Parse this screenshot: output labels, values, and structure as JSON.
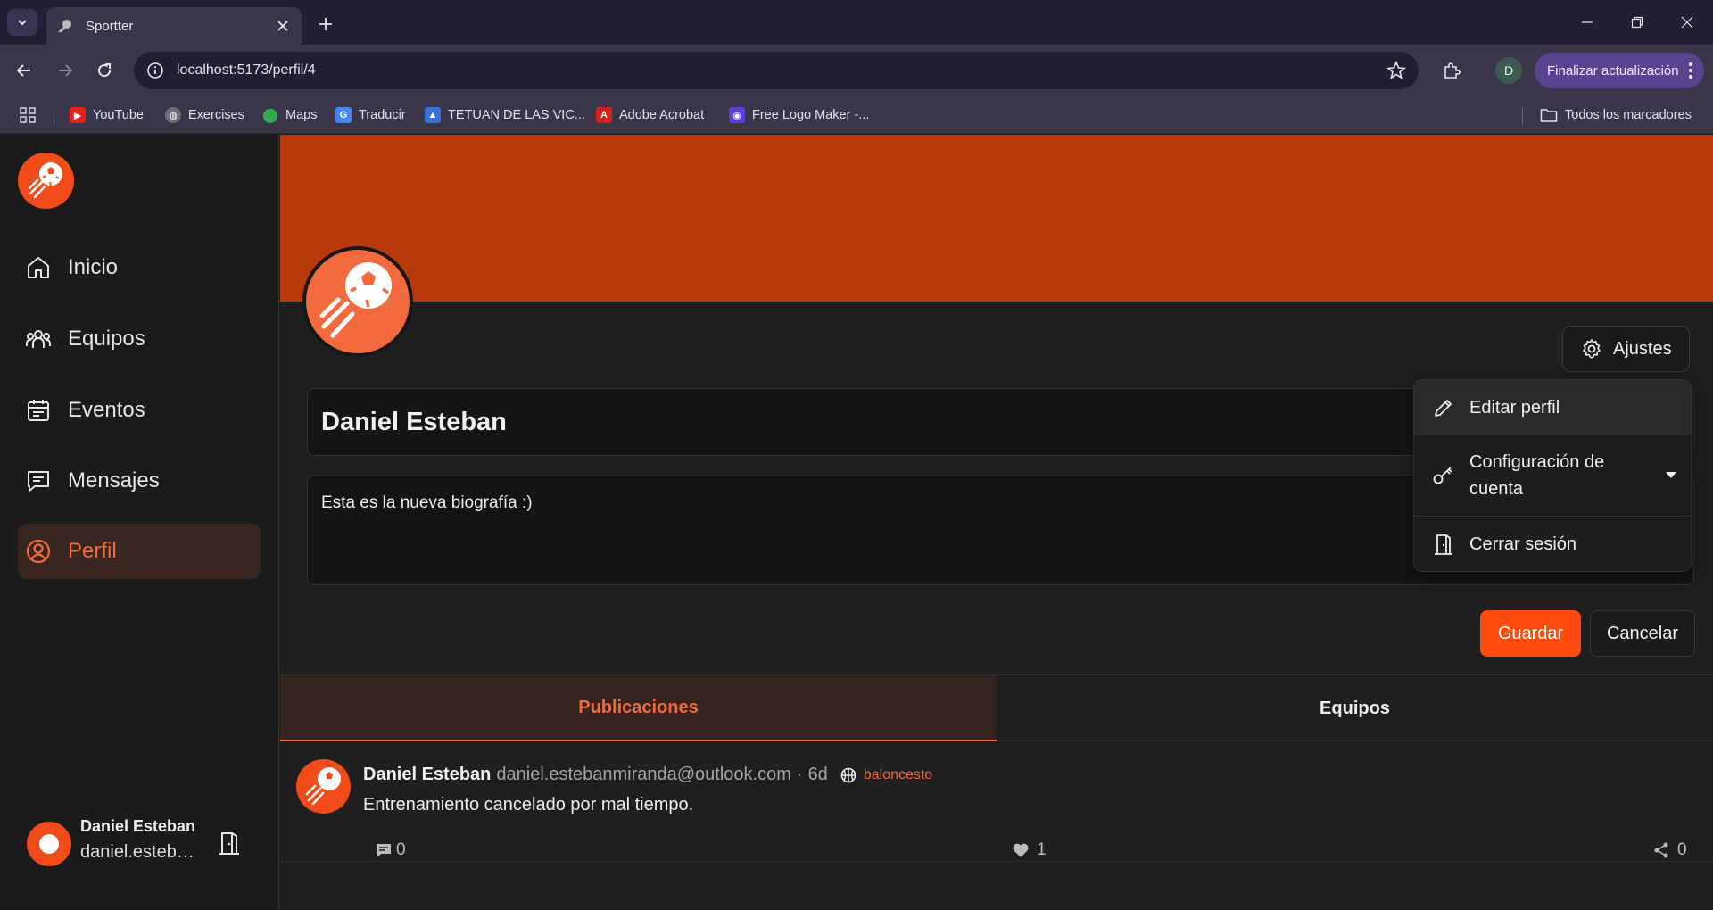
{
  "browser": {
    "tab_title": "Sportter",
    "url": "localhost:5173/perfil/4",
    "profile_initial": "D",
    "update_label": "Finalizar actualización",
    "bookmarks": [
      {
        "label": "YouTube",
        "color": "#e62117",
        "icon": "youtube-icon"
      },
      {
        "label": "Exercises",
        "color": "#9aa0a6",
        "icon": "globe-icon"
      },
      {
        "label": "Maps",
        "color": "#34a853",
        "icon": "maps-icon"
      },
      {
        "label": "Traducir",
        "color": "#4285f4",
        "icon": "translate-icon"
      },
      {
        "label": "TETUAN DE LAS VIC...",
        "color": "#3b6fd8",
        "icon": "graduation-cap-icon"
      },
      {
        "label": "Adobe Acrobat",
        "color": "#d4201a",
        "icon": "acrobat-icon"
      },
      {
        "label": "Free Logo Maker -...",
        "color": "#5b3fd6",
        "icon": "logo-maker-icon"
      }
    ],
    "all_bookmarks": "Todos los marcadores"
  },
  "sidebar": {
    "items": [
      {
        "label": "Inicio",
        "icon": "home-icon"
      },
      {
        "label": "Equipos",
        "icon": "users-icon"
      },
      {
        "label": "Eventos",
        "icon": "calendar-icon"
      },
      {
        "label": "Mensajes",
        "icon": "message-icon"
      },
      {
        "label": "Perfil",
        "icon": "user-circle-icon",
        "active": true
      }
    ],
    "user": {
      "name": "Daniel Esteban",
      "email": "daniel.estebanmiranda@outlook.com"
    }
  },
  "profile": {
    "settings_label": "Ajustes",
    "name": "Daniel Esteban",
    "bio": "Esta es la nueva biografía :)",
    "save_label": "Guardar",
    "cancel_label": "Cancelar",
    "tabs": [
      {
        "label": "Publicaciones",
        "active": true
      },
      {
        "label": "Equipos",
        "active": false
      }
    ],
    "accent_color": "#f26a3d",
    "banner_color": "#b83909"
  },
  "settings_menu": {
    "edit_profile": "Editar perfil",
    "account_config": "Configuración de cuenta",
    "logout": "Cerrar sesión"
  },
  "post": {
    "author": "Daniel Esteban",
    "email": "daniel.estebanmiranda@outlook.com",
    "separator": "·",
    "time": "6d",
    "sport": "baloncesto",
    "text": "Entrenamiento cancelado por mal tiempo.",
    "comments": "0",
    "likes": "1",
    "shares": "0"
  }
}
